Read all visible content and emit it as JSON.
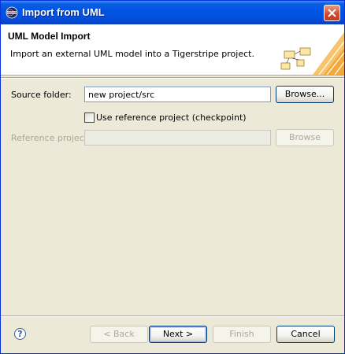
{
  "window": {
    "title": "Import from UML"
  },
  "header": {
    "title": "UML Model Import",
    "description": "Import an external UML model into a Tigerstripe project."
  },
  "form": {
    "source_folder_label": "Source folder:",
    "source_folder_value": "new project/src",
    "source_browse_label": "Browse...",
    "use_reference_label": "Use reference project (checkpoint)",
    "use_reference_checked": false,
    "reference_project_label": "Reference project",
    "reference_project_value": "",
    "reference_browse_label": "Browse"
  },
  "footer": {
    "help_label": "?",
    "back_label": "< Back",
    "next_label": "Next >",
    "finish_label": "Finish",
    "cancel_label": "Cancel"
  },
  "colors": {
    "titlebar": "#0054e3",
    "dialog_bg": "#ece9d8",
    "accent_orange": "#f6b446"
  }
}
